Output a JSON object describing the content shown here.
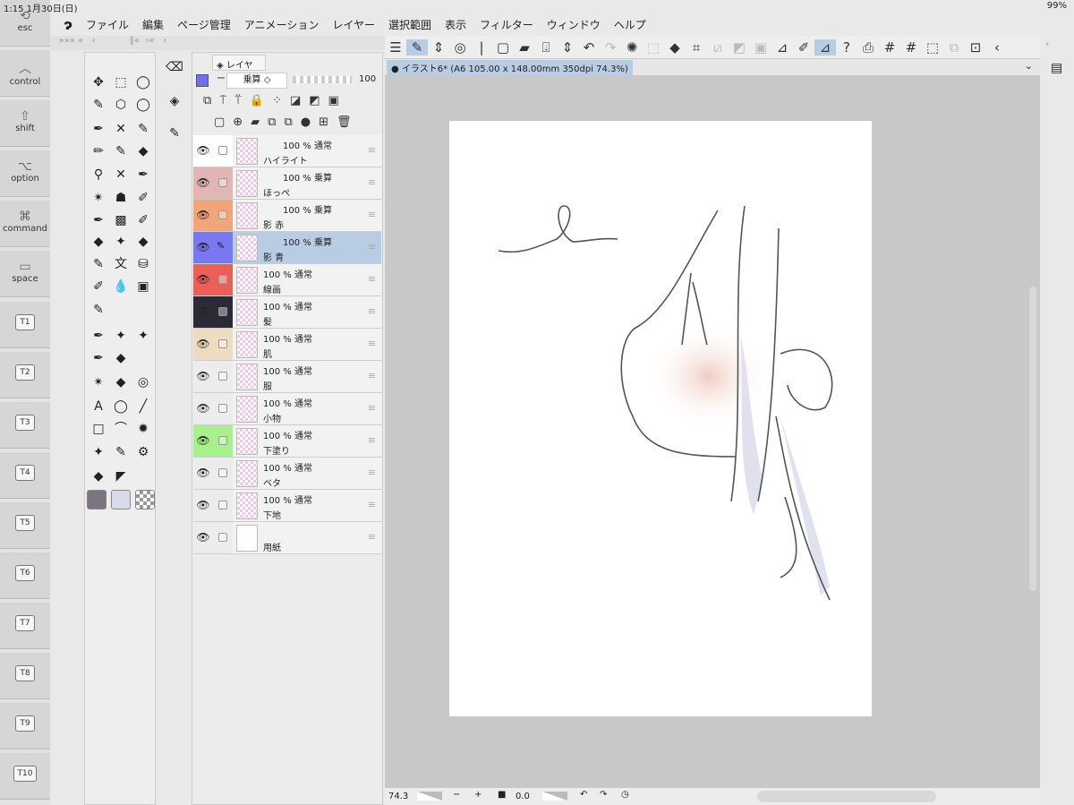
{
  "status": {
    "time": "1:15  1月30日(日)",
    "battery": "99%"
  },
  "keys": [
    {
      "label": "esc",
      "icon": "esc-icon",
      "glyph": "⟲"
    },
    {
      "label": "control",
      "icon": "control-icon",
      "glyph": "︿"
    },
    {
      "label": "shift",
      "icon": "shift-icon",
      "glyph": "⇧"
    },
    {
      "label": "option",
      "icon": "option-icon",
      "glyph": "⌥"
    },
    {
      "label": "command",
      "icon": "command-icon",
      "glyph": "⌘"
    },
    {
      "label": "space",
      "icon": "space-icon",
      "glyph": "▭"
    }
  ],
  "tkeys": [
    "T1",
    "T2",
    "T3",
    "T4",
    "T5",
    "T6",
    "T7",
    "T8",
    "T9",
    "T10"
  ],
  "menu": [
    "ファイル",
    "編集",
    "ページ管理",
    "アニメーション",
    "レイヤー",
    "選択範囲",
    "表示",
    "フィルター",
    "ウィンドウ",
    "ヘルプ"
  ],
  "layer_panel": {
    "tab": "レイヤー",
    "blend": "乗算",
    "opacity": "100",
    "accent": "#6f6ff0"
  },
  "layers": [
    {
      "name": "ハイライト",
      "opacity": "100 %",
      "blend": "通常",
      "color": "#ffffff"
    },
    {
      "name": "ほっぺ",
      "opacity": "100 %",
      "blend": "乗算",
      "color": "#e2b6b6"
    },
    {
      "name": "影 赤",
      "opacity": "100 %",
      "blend": "乗算",
      "color": "#f2a47a"
    },
    {
      "name": "影 青",
      "opacity": "100 %",
      "blend": "乗算",
      "color": "#7878f0",
      "selected": true
    },
    {
      "name": "線画",
      "opacity": "100 %",
      "blend": "通常",
      "color": "#ea5f58"
    },
    {
      "name": "髪",
      "opacity": "100 %",
      "blend": "通常",
      "color": "#2d2a38"
    },
    {
      "name": "肌",
      "opacity": "100 %",
      "blend": "通常",
      "color": "#eddcc2"
    },
    {
      "name": "服",
      "opacity": "100 %",
      "blend": "通常",
      "color": "#ececec"
    },
    {
      "name": "小物",
      "opacity": "100 %",
      "blend": "通常",
      "color": "#ececec"
    },
    {
      "name": "下塗り",
      "opacity": "100 %",
      "blend": "通常",
      "color": "#a8f08e"
    },
    {
      "name": "ベタ",
      "opacity": "100 %",
      "blend": "通常",
      "color": "#ececec"
    },
    {
      "name": "下地",
      "opacity": "100 %",
      "blend": "通常",
      "color": "#ececec"
    },
    {
      "name": "用紙",
      "opacity": "",
      "blend": "",
      "color": "#ececec",
      "paper": true
    }
  ],
  "document": {
    "tab": "● イラスト6* (A6 105.00 x 148.00mm 350dpi 74.3%)"
  },
  "bottom": {
    "zoom": "74.3",
    "rotation": "0.0"
  }
}
